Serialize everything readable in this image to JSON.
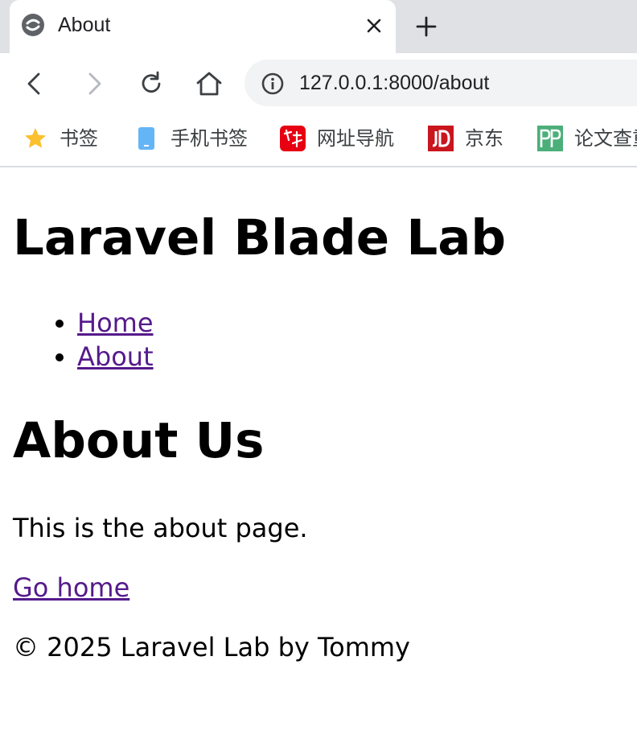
{
  "browser": {
    "tab": {
      "title": "About"
    },
    "address_bar": {
      "url": "127.0.0.1:8000/about"
    },
    "bookmarks": [
      {
        "label": "书签",
        "icon": "star-icon"
      },
      {
        "label": "手机书签",
        "icon": "mobile-bookmark-icon"
      },
      {
        "label": "网址导航",
        "icon": "hao-nav-icon"
      },
      {
        "label": "京东",
        "icon": "jd-icon"
      },
      {
        "label": "论文查重",
        "icon": "pp-icon"
      }
    ]
  },
  "page": {
    "site_title": "Laravel Blade Lab",
    "nav": [
      {
        "label": "Home"
      },
      {
        "label": "About"
      }
    ],
    "heading": "About Us",
    "description": "This is the about page.",
    "home_link": "Go home",
    "footer": "© 2025 Laravel Lab by Tommy"
  },
  "colors": {
    "link_visited": "#551a8b",
    "tabstrip": "#dfe1e5",
    "omnibox": "#f1f3f4"
  }
}
